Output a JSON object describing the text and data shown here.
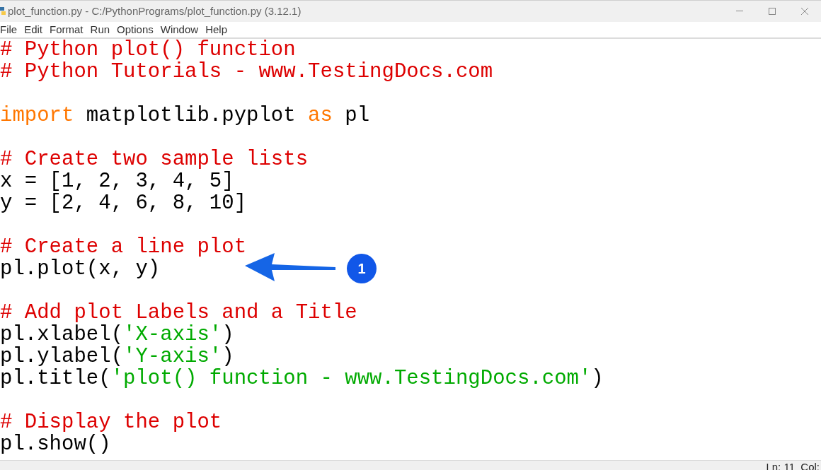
{
  "window": {
    "title": "plot_function.py - C:/PythonPrograms/plot_function.py (3.12.1)"
  },
  "menu": [
    "File",
    "Edit",
    "Format",
    "Run",
    "Options",
    "Window",
    "Help"
  ],
  "editor": {
    "lines": [
      {
        "kind": "code",
        "tokens": [
          {
            "text": "# Python plot() function",
            "kind": "comment"
          }
        ]
      },
      {
        "kind": "code",
        "tokens": [
          {
            "text": "# Python Tutorials - www.TestingDocs.com",
            "kind": "comment"
          }
        ]
      },
      {
        "kind": "blank"
      },
      {
        "kind": "code",
        "tokens": [
          {
            "text": "import",
            "kind": "keyword"
          },
          {
            "text": " matplotlib.pyplot ",
            "kind": "plain"
          },
          {
            "text": "as",
            "kind": "keyword"
          },
          {
            "text": " pl",
            "kind": "plain"
          }
        ]
      },
      {
        "kind": "blank"
      },
      {
        "kind": "code",
        "tokens": [
          {
            "text": "# Create two sample lists",
            "kind": "comment"
          }
        ]
      },
      {
        "kind": "code",
        "tokens": [
          {
            "text": "x = [1, 2, 3, 4, 5]",
            "kind": "plain"
          }
        ]
      },
      {
        "kind": "code",
        "tokens": [
          {
            "text": "y = [2, 4, 6, 8, 10]",
            "kind": "plain"
          }
        ]
      },
      {
        "kind": "blank"
      },
      {
        "kind": "code",
        "tokens": [
          {
            "text": "# Create a line plot",
            "kind": "comment"
          }
        ]
      },
      {
        "kind": "code",
        "tokens": [
          {
            "text": "pl.plot(x, y)",
            "kind": "plain"
          }
        ]
      },
      {
        "kind": "blank"
      },
      {
        "kind": "code",
        "tokens": [
          {
            "text": "# Add plot Labels and a Title",
            "kind": "comment"
          }
        ]
      },
      {
        "kind": "code",
        "tokens": [
          {
            "text": "pl.xlabel(",
            "kind": "plain"
          },
          {
            "text": "'X-axis'",
            "kind": "string"
          },
          {
            "text": ")",
            "kind": "plain"
          }
        ]
      },
      {
        "kind": "code",
        "tokens": [
          {
            "text": "pl.ylabel(",
            "kind": "plain"
          },
          {
            "text": "'Y-axis'",
            "kind": "string"
          },
          {
            "text": ")",
            "kind": "plain"
          }
        ]
      },
      {
        "kind": "code",
        "tokens": [
          {
            "text": "pl.title(",
            "kind": "plain"
          },
          {
            "text": "'plot() function - www.TestingDocs.com'",
            "kind": "string"
          },
          {
            "text": ")",
            "kind": "plain"
          }
        ]
      },
      {
        "kind": "blank"
      },
      {
        "kind": "code",
        "tokens": [
          {
            "text": "# Display the plot",
            "kind": "comment"
          }
        ]
      },
      {
        "kind": "code",
        "tokens": [
          {
            "text": "pl.show()",
            "kind": "plain"
          }
        ]
      }
    ]
  },
  "callout": {
    "badge": "1"
  },
  "status_bar": {
    "position": "Ln: 11  Col:"
  }
}
